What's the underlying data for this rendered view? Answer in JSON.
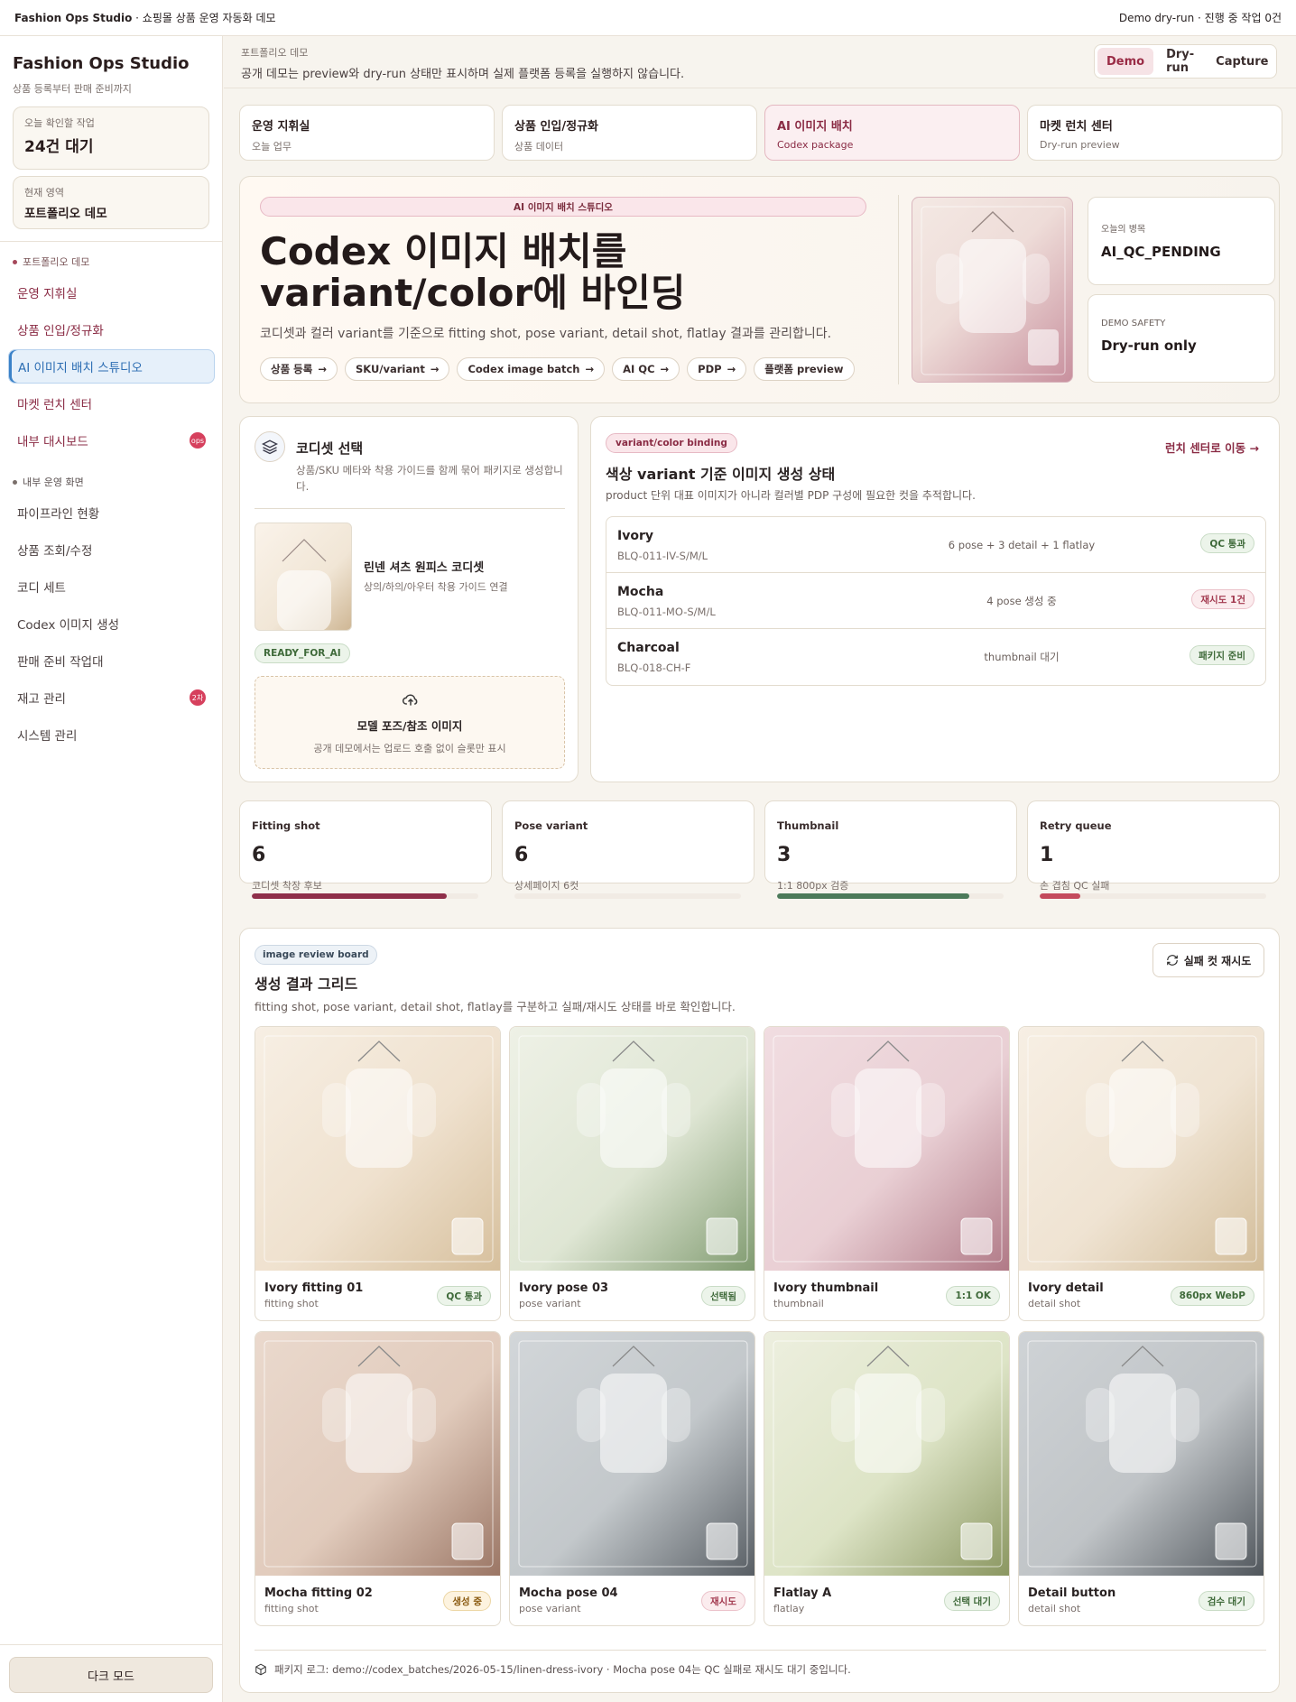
{
  "topbar": {
    "brand": "Fashion Ops Studio",
    "subtitle": " · 쇼핑몰 상품 운영 자동화 데모",
    "status": "Demo dry-run · 진행 중 작업 0건"
  },
  "sidebar": {
    "title": "Fashion Ops Studio",
    "subtitle": "상품 등록부터 판매 준비까지",
    "today_label": "오늘 확인할 작업",
    "today_value": "24건 대기",
    "area_label": "현재 영역",
    "area_value": "포트폴리오 데모",
    "section1": "포트폴리오 데모",
    "items1": [
      {
        "label": "운영 지휘실"
      },
      {
        "label": "상품 인입/정규화"
      },
      {
        "label": "AI 이미지 배치 스튜디오"
      },
      {
        "label": "마켓 런치 센터"
      },
      {
        "label": "내부 대시보드",
        "badge": "ops"
      }
    ],
    "section2": "내부 운영 화면",
    "items2": [
      {
        "label": "파이프라인 현황"
      },
      {
        "label": "상품 조회/수정"
      },
      {
        "label": "코디 세트"
      },
      {
        "label": "Codex 이미지 생성"
      },
      {
        "label": "판매 준비 작업대"
      },
      {
        "label": "재고 관리",
        "badge": "2차"
      },
      {
        "label": "시스템 관리"
      }
    ],
    "dark_mode": "다크 모드"
  },
  "header": {
    "label": "포트폴리오 데모",
    "desc": "공개 데모는 preview와 dry-run 상태만 표시하며 실제 플랫폼 등록을 실행하지 않습니다.",
    "modes": [
      "Demo",
      "Dry-run",
      "Capture"
    ]
  },
  "tabs": [
    {
      "title": "운영 지휘실",
      "sub": "오늘 업무"
    },
    {
      "title": "상품 인입/정규화",
      "sub": "상품 데이터"
    },
    {
      "title": "AI 이미지 배치",
      "sub": "Codex package"
    },
    {
      "title": "마켓 런치 센터",
      "sub": "Dry-run preview"
    }
  ],
  "hero": {
    "pill": "AI 이미지 배치 스튜디오",
    "title": "Codex 이미지 배치를 variant/color에 바인딩",
    "desc": "코디셋과 컬러 variant를 기준으로 fitting shot, pose variant, detail shot, flatlay 결과를 관리합니다.",
    "chips": [
      "상품 등록",
      "SKU/variant",
      "Codex image batch",
      "AI QC",
      "PDP",
      "플랫폼 preview"
    ],
    "bottleneck_label": "오늘의 병목",
    "bottleneck_value": "AI_QC_PENDING",
    "safety_label": "DEMO SAFETY",
    "safety_value": "Dry-run only"
  },
  "codi": {
    "title": "코디셋 선택",
    "desc": "상품/SKU 메타와 착용 가이드를 함께 묶어 패키지로 생성합니다.",
    "product_name": "린넨 셔츠 원피스 코디셋",
    "product_desc": "상의/하의/아우터 착용 가이드 연결",
    "status": "READY_FOR_AI",
    "upload_title": "모델 포즈/참조 이미지",
    "upload_desc": "공개 데모에서는 업로드 호출 없이 슬롯만 표시"
  },
  "binding": {
    "tag": "variant/color binding",
    "title": "색상 variant 기준 이미지 생성 상태",
    "desc": "product 단위 대표 이미지가 아니라 컬러별 PDP 구성에 필요한 컷을 추적합니다.",
    "link": "런치 센터로 이동",
    "rows": [
      {
        "name": "Ivory",
        "sku": "BLQ-011-IV-S/M/L",
        "info": "6 pose + 3 detail + 1 flatlay",
        "badge": "QC 통과"
      },
      {
        "name": "Mocha",
        "sku": "BLQ-011-MO-S/M/L",
        "info": "4 pose 생성 중",
        "badge": "재시도 1건"
      },
      {
        "name": "Charcoal",
        "sku": "BLQ-018-CH-F",
        "info": "thumbnail 대기",
        "badge": "패키지 준비"
      }
    ]
  },
  "stats": [
    {
      "label": "Fitting shot",
      "value": "6",
      "sub": "코디셋 착장 후보",
      "progress": 0.86,
      "color": "#8f2f4a"
    },
    {
      "label": "Pose variant",
      "value": "6",
      "sub": "상세페이지 6컷",
      "progress": 0.0,
      "color": "#dfe6ef"
    },
    {
      "label": "Thumbnail",
      "value": "3",
      "sub": "1:1 800px 검증",
      "progress": 0.85,
      "color": "#4c7a5a"
    },
    {
      "label": "Retry queue",
      "value": "1",
      "sub": "손 겹침 QC 실패",
      "progress": 0.18,
      "color": "#c44a5c"
    }
  ],
  "grid": {
    "tag": "image review board",
    "title": "생성 결과 그리드",
    "desc": "fitting shot, pose variant, detail shot, flatlay를 구분하고 실패/재시도 상태를 바로 확인합니다.",
    "retry": "실패 컷 재시도",
    "items": [
      {
        "title": "Ivory fitting 01",
        "type": "fitting shot",
        "badge": "QC 통과"
      },
      {
        "title": "Ivory pose 03",
        "type": "pose variant",
        "badge": "선택됨"
      },
      {
        "title": "Ivory thumbnail",
        "type": "thumbnail",
        "badge": "1:1 OK"
      },
      {
        "title": "Ivory detail",
        "type": "detail shot",
        "badge": "860px WebP"
      },
      {
        "title": "Mocha fitting 02",
        "type": "fitting shot",
        "badge": "생성 중"
      },
      {
        "title": "Mocha pose 04",
        "type": "pose variant",
        "badge": "재시도"
      },
      {
        "title": "Flatlay A",
        "type": "flatlay",
        "badge": "선택 대기"
      },
      {
        "title": "Detail button",
        "type": "detail shot",
        "badge": "검수 대기"
      }
    ],
    "footer": "패키지 로그: demo://codex_batches/2026-05-15/linen-dress-ivory · Mocha pose 04는 QC 실패로 재시도 대기 중입니다."
  }
}
